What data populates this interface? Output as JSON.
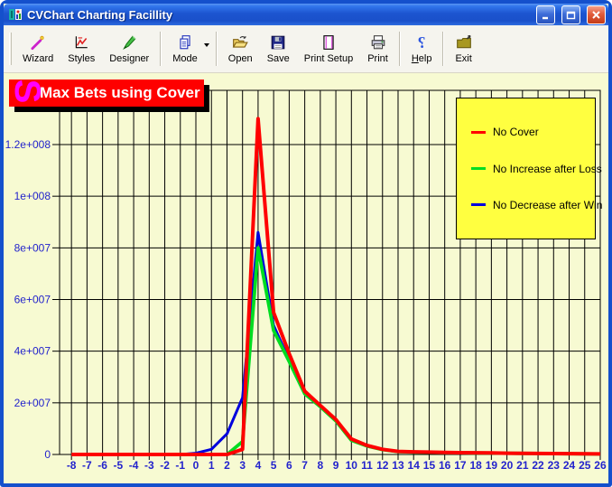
{
  "window": {
    "title": "CVChart Charting Facillity",
    "controls": [
      "minimize",
      "maximize",
      "close"
    ]
  },
  "toolbar": {
    "buttons": [
      {
        "id": "wizard",
        "label": "Wizard",
        "icon": "magic-wand-icon"
      },
      {
        "id": "styles",
        "label": "Styles",
        "icon": "chart-styles-icon"
      },
      {
        "id": "designer",
        "label": "Designer",
        "icon": "marker-pen-icon"
      },
      {
        "id": "mode",
        "label": "Mode",
        "icon": "copy-pages-icon",
        "has_dropdown": true,
        "group_start": true
      },
      {
        "id": "open",
        "label": "Open",
        "icon": "open-folder-icon",
        "group_start": true
      },
      {
        "id": "save",
        "label": "Save",
        "icon": "floppy-disk-icon"
      },
      {
        "id": "print-setup",
        "label": "Print Setup",
        "icon": "page-setup-icon"
      },
      {
        "id": "print",
        "label": "Print",
        "icon": "printer-icon"
      },
      {
        "id": "help",
        "label": "Help",
        "icon": "question-mark-icon",
        "underline_first": true,
        "group_start": true
      },
      {
        "id": "exit",
        "label": "Exit",
        "icon": "exit-folder-icon",
        "group_start": true
      }
    ]
  },
  "chart": {
    "banner_title": "Max Bets using Cover",
    "logo_glyph": "S",
    "question_glyph": "?",
    "colors": {
      "banner_bg": "#FF0000",
      "banner_text": "#FFFFFF",
      "legend_bg": "#FFFF40",
      "plot_bg": "#F7FAD2",
      "grid": "#000000",
      "axis_text": "#2323CC",
      "logo": "#FF00FF"
    }
  },
  "chart_data": {
    "type": "line",
    "title": "Max Bets using Cover",
    "xlabel": "",
    "ylabel": "",
    "grid": "both",
    "legend_position": "top-right",
    "xlim": [
      -8.8,
      26
    ],
    "ylim": [
      0,
      141000000
    ],
    "x_ticks": [
      -8,
      -7,
      -6,
      -5,
      -4,
      -3,
      -2,
      -1,
      0,
      1,
      2,
      3,
      4,
      5,
      6,
      7,
      8,
      9,
      10,
      11,
      12,
      13,
      14,
      15,
      16,
      17,
      18,
      19,
      20,
      21,
      22,
      23,
      24,
      25,
      26
    ],
    "y_ticks": [
      {
        "value": 0,
        "label": "0"
      },
      {
        "value": 20000000,
        "label": "2e+007"
      },
      {
        "value": 40000000,
        "label": "4e+007"
      },
      {
        "value": 60000000,
        "label": "6e+007"
      },
      {
        "value": 80000000,
        "label": "8e+007"
      },
      {
        "value": 100000000,
        "label": "1e+008"
      },
      {
        "value": 120000000,
        "label": "1.2e+008"
      }
    ],
    "x": [
      -8,
      -7,
      -6,
      -5,
      -4,
      -3,
      -2,
      -1,
      0,
      1,
      2,
      3,
      4,
      5,
      6,
      7,
      8,
      9,
      10,
      11,
      12,
      13,
      14,
      15,
      16,
      17,
      18,
      19,
      20,
      21,
      22,
      23,
      24,
      25,
      26
    ],
    "series": [
      {
        "name": "No Cover",
        "color": "#FF0000",
        "values": [
          0,
          0,
          0,
          0,
          0,
          0,
          0,
          0,
          0,
          0,
          0,
          2000000,
          130000000,
          55000000,
          39000000,
          24500000,
          19000000,
          13500000,
          6000000,
          3500000,
          2000000,
          1200000,
          1000000,
          900000,
          800000,
          700000,
          650000,
          600000,
          500000,
          450000,
          400000,
          350000,
          300000,
          250000,
          200000
        ]
      },
      {
        "name": "No Increase after Loss",
        "color": "#00DD22",
        "values": [
          0,
          0,
          0,
          0,
          0,
          0,
          0,
          0,
          0,
          0,
          0,
          5000000,
          80000000,
          48000000,
          36000000,
          23500000,
          18500000,
          13000000,
          5500000,
          3300000,
          1900000,
          1100000,
          950000,
          850000,
          750000,
          650000,
          600000,
          550000,
          480000,
          420000,
          380000,
          330000,
          280000,
          230000,
          180000
        ]
      },
      {
        "name": "No Decrease after Win",
        "color": "#0000DD",
        "values": [
          0,
          0,
          0,
          0,
          0,
          0,
          0,
          0,
          500000,
          2000000,
          8000000,
          22000000,
          86000000,
          50000000,
          36500000,
          23500000,
          18500000,
          13000000,
          5500000,
          3300000,
          1900000,
          1100000,
          950000,
          850000,
          750000,
          650000,
          600000,
          550000,
          480000,
          420000,
          380000,
          330000,
          280000,
          230000,
          180000
        ]
      }
    ]
  }
}
